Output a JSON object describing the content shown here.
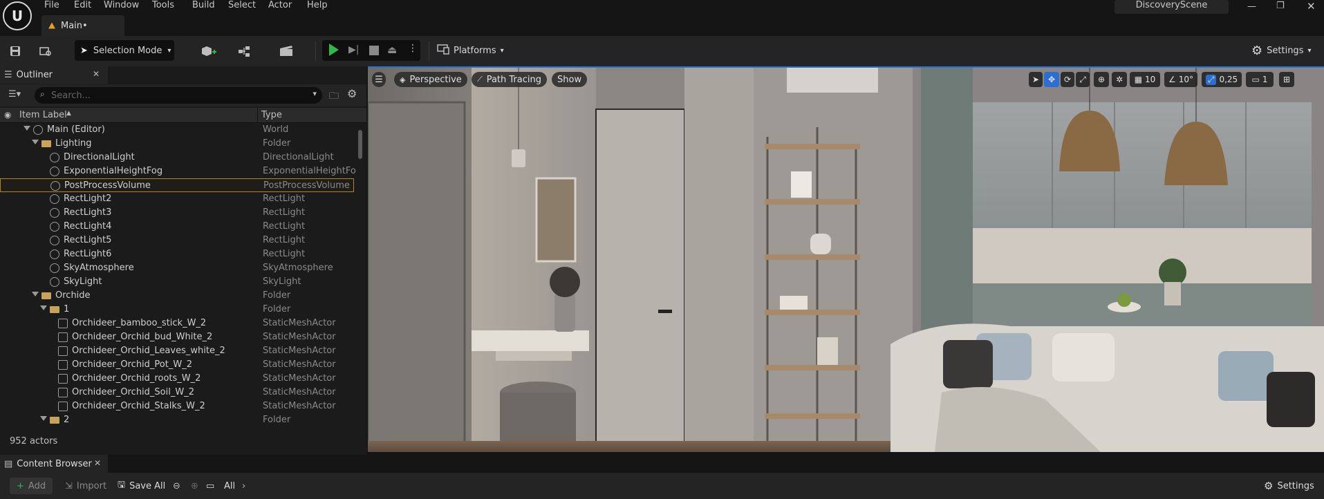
{
  "menu": {
    "items": [
      "File",
      "Edit",
      "Window",
      "Tools",
      "Build",
      "Select",
      "Actor",
      "Help"
    ],
    "tab_label": "Main•",
    "project": "DiscoveryScene"
  },
  "toolbar": {
    "selection_mode": "Selection Mode",
    "platforms": "Platforms",
    "settings": "Settings"
  },
  "outliner": {
    "tab_label": "Outliner",
    "search_placeholder": "Search...",
    "col_label": "Item Label",
    "col_type": "Type",
    "actor_count": "952 actors",
    "rows": [
      {
        "label": "Main (Editor)",
        "type": "World",
        "icon": "world-icon"
      },
      {
        "label": "Lighting",
        "type": "Folder",
        "icon": "folder-icon"
      },
      {
        "label": "DirectionalLight",
        "type": "DirectionalLight",
        "icon": "directional-light-icon"
      },
      {
        "label": "ExponentialHeightFog",
        "type": "ExponentialHeightFog",
        "icon": "fog-icon"
      },
      {
        "label": "PostProcessVolume",
        "type": "PostProcessVolume",
        "icon": "post-process-icon"
      },
      {
        "label": "RectLight2",
        "type": "RectLight",
        "icon": "rect-light-icon"
      },
      {
        "label": "RectLight3",
        "type": "RectLight",
        "icon": "rect-light-icon"
      },
      {
        "label": "RectLight4",
        "type": "RectLight",
        "icon": "rect-light-icon"
      },
      {
        "label": "RectLight5",
        "type": "RectLight",
        "icon": "rect-light-icon"
      },
      {
        "label": "RectLight6",
        "type": "RectLight",
        "icon": "rect-light-icon"
      },
      {
        "label": "SkyAtmosphere",
        "type": "SkyAtmosphere",
        "icon": "sky-atmosphere-icon"
      },
      {
        "label": "SkyLight",
        "type": "SkyLight",
        "icon": "sky-light-icon"
      },
      {
        "label": "Orchide",
        "type": "Folder",
        "icon": "folder-icon"
      },
      {
        "label": "1",
        "type": "Folder",
        "icon": "folder-icon"
      },
      {
        "label": "Orchideer_bamboo_stick_W_2",
        "type": "StaticMeshActor",
        "icon": "static-mesh-icon"
      },
      {
        "label": "Orchideer_Orchid_bud_White_2",
        "type": "StaticMeshActor",
        "icon": "static-mesh-icon"
      },
      {
        "label": "Orchideer_Orchid_Leaves_white_2",
        "type": "StaticMeshActor",
        "icon": "static-mesh-icon"
      },
      {
        "label": "Orchideer_Orchid_Pot_W_2",
        "type": "StaticMeshActor",
        "icon": "static-mesh-icon"
      },
      {
        "label": "Orchideer_Orchid_roots_W_2",
        "type": "StaticMeshActor",
        "icon": "static-mesh-icon"
      },
      {
        "label": "Orchideer_Orchid_Soil_W_2",
        "type": "StaticMeshActor",
        "icon": "static-mesh-icon"
      },
      {
        "label": "Orchideer_Orchid_Stalks_W_2",
        "type": "StaticMeshActor",
        "icon": "static-mesh-icon"
      },
      {
        "label": "2",
        "type": "Folder",
        "icon": "folder-icon"
      }
    ]
  },
  "viewport": {
    "perspective": "Perspective",
    "path_tracing": "Path Tracing",
    "show": "Show",
    "grid_snap": "10",
    "rot_snap": "10°",
    "scale_snap": "0,25",
    "camera_speed": "1"
  },
  "content_browser": {
    "tab_label": "Content Browser",
    "add": "Add",
    "import": "Import",
    "save_all": "Save All",
    "path": "All",
    "settings": "Settings"
  }
}
